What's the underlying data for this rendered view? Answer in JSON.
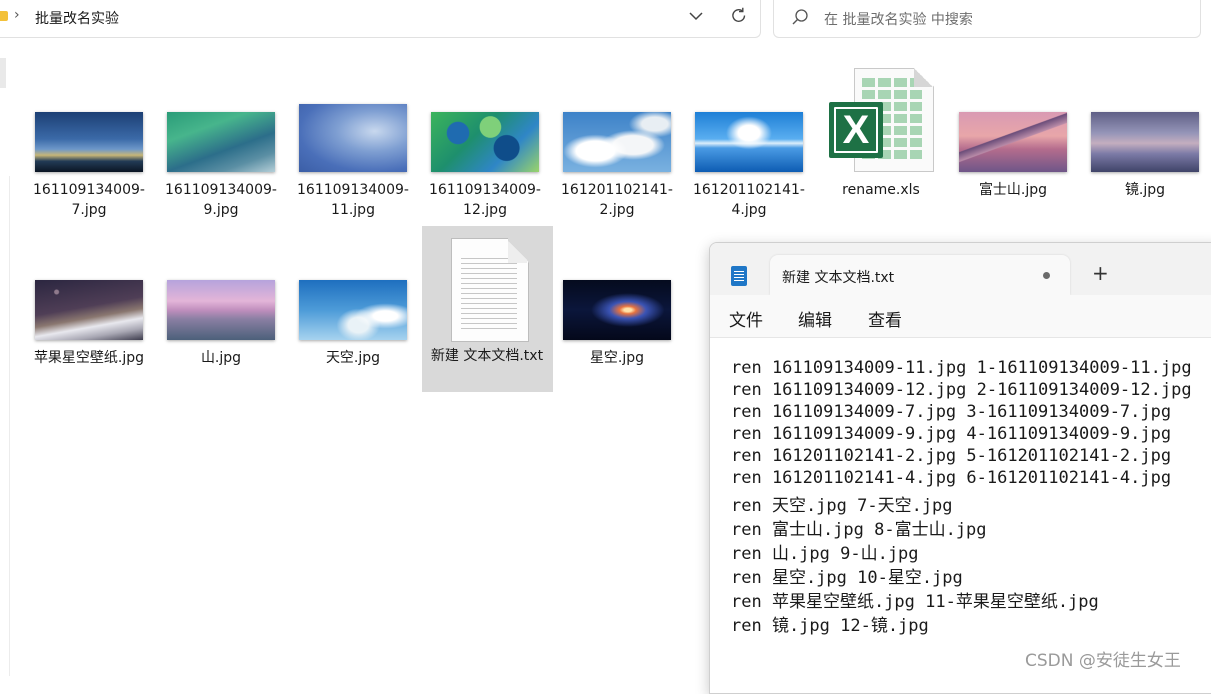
{
  "explorer": {
    "breadcrumb": "批量改名实验",
    "search_placeholder": "在 批量改名实验 中搜索",
    "files": [
      {
        "name": "161109134009-7.jpg",
        "type": "image"
      },
      {
        "name": "161109134009-9.jpg",
        "type": "image"
      },
      {
        "name": "161109134009-11.jpg",
        "type": "image"
      },
      {
        "name": "161109134009-12.jpg",
        "type": "image"
      },
      {
        "name": "161201102141-2.jpg",
        "type": "image"
      },
      {
        "name": "161201102141-4.jpg",
        "type": "image"
      },
      {
        "name": "rename.xls",
        "type": "excel"
      },
      {
        "name": "富士山.jpg",
        "type": "image"
      },
      {
        "name": "镜.jpg",
        "type": "image"
      },
      {
        "name": "苹果星空壁纸.jpg",
        "type": "image"
      },
      {
        "name": "山.jpg",
        "type": "image"
      },
      {
        "name": "天空.jpg",
        "type": "image"
      },
      {
        "name": "新建 文本文档.txt",
        "type": "text",
        "selected": true
      },
      {
        "name": "星空.jpg",
        "type": "image"
      }
    ]
  },
  "notepad": {
    "tab_title": "新建 文本文档.txt",
    "new_tab": "+",
    "menu": {
      "file": "文件",
      "edit": "编辑",
      "view": "查看"
    },
    "lines": [
      "ren 161109134009-11.jpg 1-161109134009-11.jpg",
      "ren 161109134009-12.jpg 2-161109134009-12.jpg",
      "ren 161109134009-7.jpg 3-161109134009-7.jpg",
      "ren 161109134009-9.jpg 4-161109134009-9.jpg",
      "ren 161201102141-2.jpg 5-161201102141-2.jpg",
      "ren 161201102141-4.jpg 6-161201102141-4.jpg",
      "ren 天空.jpg 7-天空.jpg",
      "ren 富士山.jpg 8-富士山.jpg",
      "ren 山.jpg 9-山.jpg",
      "ren 星空.jpg 10-星空.jpg",
      "ren 苹果星空壁纸.jpg 11-苹果星空壁纸.jpg",
      "ren 镜.jpg 12-镜.jpg"
    ]
  },
  "watermark": "CSDN @安徒生女王",
  "icons": {
    "breadcrumb_separator": "chevron-right-icon",
    "dropdown": "chevron-down-icon",
    "refresh": "refresh-icon",
    "search": "search-icon"
  }
}
